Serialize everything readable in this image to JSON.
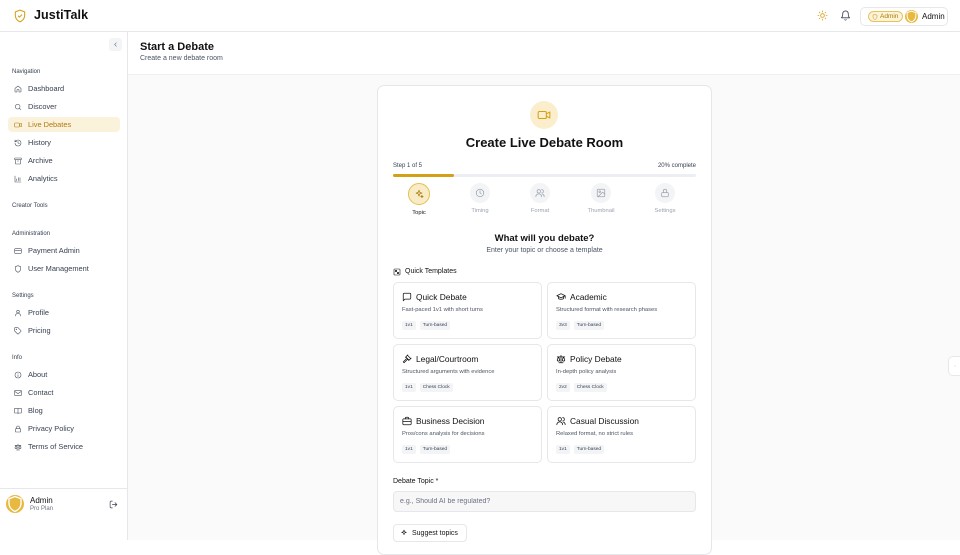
{
  "app": {
    "name": "JustiTalk"
  },
  "header": {
    "role_badge": "Admin",
    "user_name": "Admin"
  },
  "sidebar": {
    "sections": [
      {
        "title": "Navigation"
      },
      {
        "title": "Creator Tools"
      },
      {
        "title": "Administration"
      },
      {
        "title": "Settings"
      },
      {
        "title": "Info"
      }
    ],
    "items": [
      {
        "label": "Dashboard",
        "icon": "home-icon"
      },
      {
        "label": "Discover",
        "icon": "search-icon"
      },
      {
        "label": "Live Debates",
        "icon": "video-icon",
        "active": true
      },
      {
        "label": "History",
        "icon": "history-icon"
      },
      {
        "label": "Archive",
        "icon": "archive-icon"
      },
      {
        "label": "Analytics",
        "icon": "bar-chart-icon"
      },
      {
        "label": "Payment Admin",
        "icon": "credit-card-icon"
      },
      {
        "label": "User Management",
        "icon": "shield-icon"
      },
      {
        "label": "Profile",
        "icon": "user-icon"
      },
      {
        "label": "Pricing",
        "icon": "tag-icon"
      },
      {
        "label": "About",
        "icon": "info-icon"
      },
      {
        "label": "Contact",
        "icon": "mail-icon"
      },
      {
        "label": "Blog",
        "icon": "book-icon"
      },
      {
        "label": "Privacy Policy",
        "icon": "lock-icon"
      },
      {
        "label": "Terms of Service",
        "icon": "scale-icon"
      }
    ],
    "footer": {
      "name": "Admin",
      "plan": "Pro Plan"
    }
  },
  "page": {
    "title": "Start a Debate",
    "subtitle": "Create a new debate room"
  },
  "wizard": {
    "title": "Create Live Debate Room",
    "step_text": "Step 1 of 5",
    "percent_text": "20% complete",
    "progress": 0.2,
    "steps": [
      {
        "label": "Topic",
        "icon": "sparkles-icon",
        "active": true
      },
      {
        "label": "Timing",
        "icon": "clock-icon"
      },
      {
        "label": "Format",
        "icon": "users-icon"
      },
      {
        "label": "Thumbnail",
        "icon": "image-icon"
      },
      {
        "label": "Settings",
        "icon": "lock-icon"
      }
    ],
    "question": "What will you debate?",
    "hint": "Enter your topic or choose a template",
    "templates_label": "Quick Templates",
    "templates": [
      {
        "name": "Quick Debate",
        "desc": "Fast-paced 1v1 with short turns",
        "tags": [
          "1v1",
          "Turn-based"
        ],
        "icon": "message-square-icon"
      },
      {
        "name": "Academic",
        "desc": "Structured format with research phases",
        "tags": [
          "3v3",
          "Turn-based"
        ],
        "icon": "graduation-cap-icon"
      },
      {
        "name": "Legal/Courtroom",
        "desc": "Structured arguments with evidence",
        "tags": [
          "1v1",
          "Chess Clock"
        ],
        "icon": "gavel-icon"
      },
      {
        "name": "Policy Debate",
        "desc": "In-depth policy analysis",
        "tags": [
          "2v2",
          "Chess Clock"
        ],
        "icon": "scale-icon"
      },
      {
        "name": "Business Decision",
        "desc": "Pros/cons analysis for decisions",
        "tags": [
          "1v1",
          "Turn-based"
        ],
        "icon": "briefcase-icon"
      },
      {
        "name": "Casual Discussion",
        "desc": "Relaxed format, no strict rules",
        "tags": [
          "1v1",
          "Turn-based"
        ],
        "icon": "users-icon"
      }
    ],
    "topic_label": "Debate Topic *",
    "topic_placeholder": "e.g., Should AI be regulated?",
    "topic_value": "",
    "suggest_label": "Suggest topics"
  },
  "colors": {
    "accent": "#d4a017",
    "active_bg": "#fbf2db"
  }
}
